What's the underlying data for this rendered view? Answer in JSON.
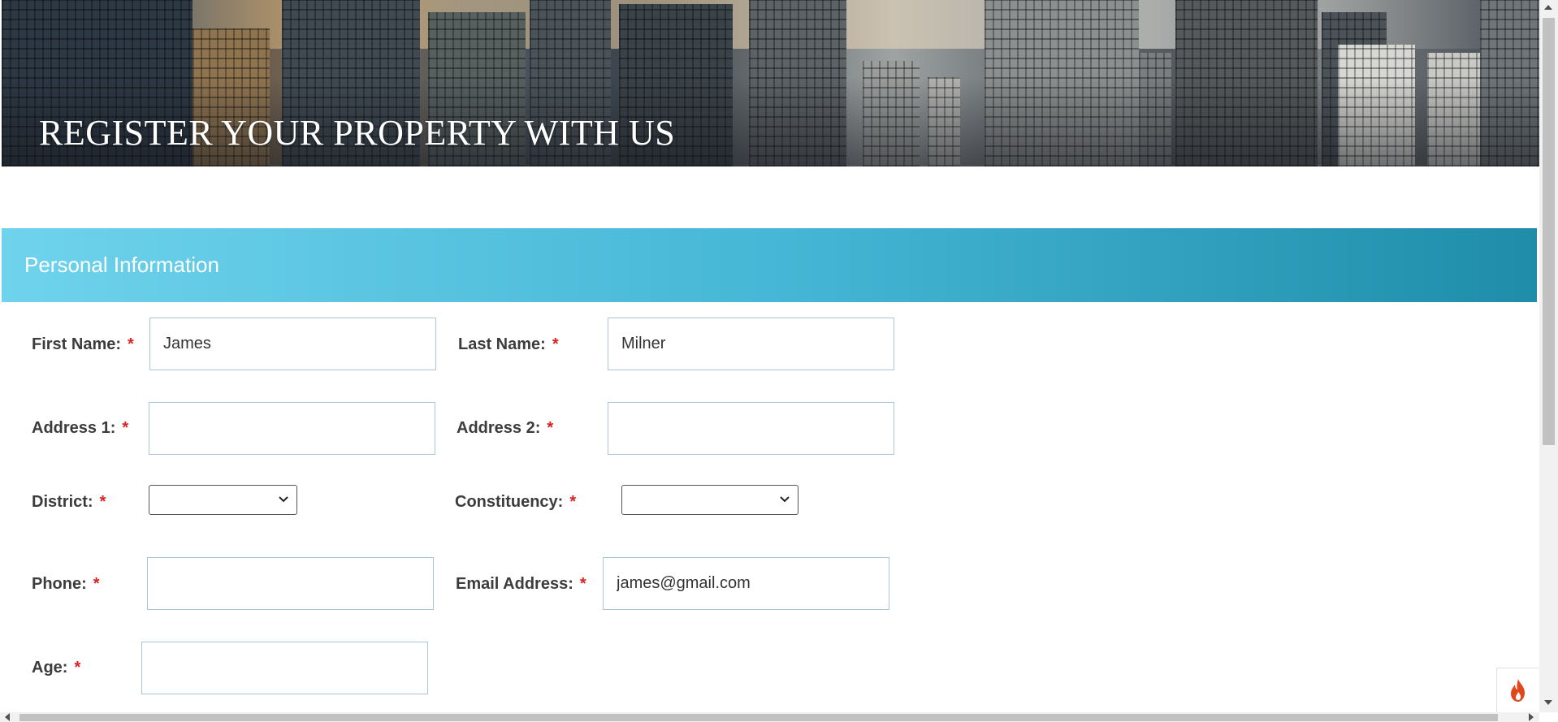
{
  "hero": {
    "title": "REGISTER YOUR PROPERTY WITH US"
  },
  "section": {
    "title": "Personal Information"
  },
  "form": {
    "required_marker": "*",
    "first_name": {
      "label": "First Name:",
      "value": "James"
    },
    "last_name": {
      "label": "Last Name:",
      "value": "Milner"
    },
    "address1": {
      "label": "Address 1:",
      "value": ""
    },
    "address2": {
      "label": "Address 2:",
      "value": ""
    },
    "district": {
      "label": "District:",
      "selected": ""
    },
    "constituency": {
      "label": "Constituency:",
      "selected": ""
    },
    "phone": {
      "label": "Phone:",
      "value": ""
    },
    "email": {
      "label": "Email Address:",
      "value": "james@gmail.com"
    },
    "age": {
      "label": "Age:",
      "value": ""
    }
  },
  "colors": {
    "section_gradient_start": "#6fd3ec",
    "section_gradient_end": "#1f8daa",
    "required": "#e02020",
    "input_border": "#aac6d9"
  },
  "icons": {
    "floating_button": "flame-icon",
    "select_arrow": "chevron-down-icon"
  }
}
